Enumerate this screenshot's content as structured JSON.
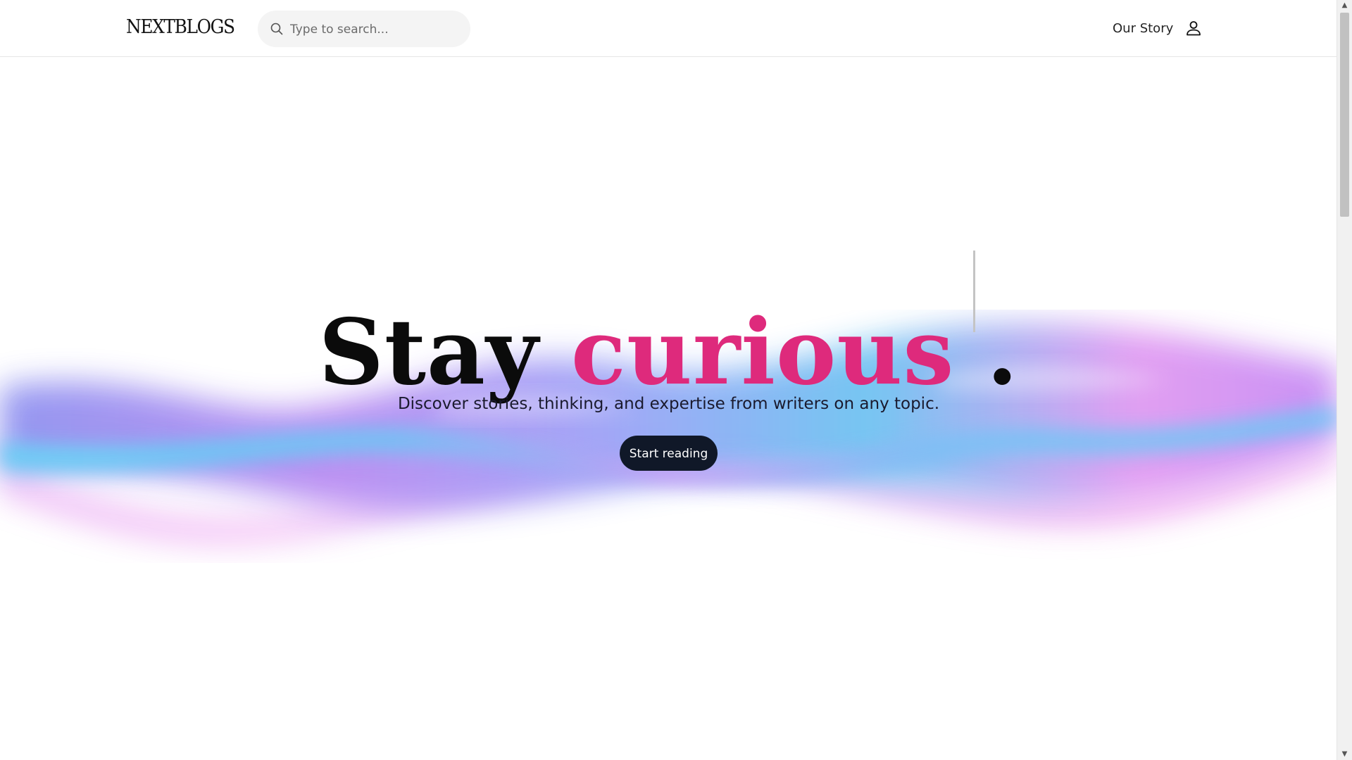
{
  "header": {
    "logo": "NEXTBLOGS",
    "search": {
      "placeholder": "Type to search...",
      "value": ""
    },
    "nav_link": "Our Story",
    "icons": {
      "search": "search-icon",
      "user": "user-icon"
    }
  },
  "hero": {
    "title_word1": "Stay",
    "title_word2": "curious",
    "title_punct": " .",
    "subtitle": "Discover stories, thinking, and expertise from writers on any topic.",
    "cta_label": "Start reading"
  },
  "colors": {
    "accent": "#de2a7c",
    "button": "#101828",
    "wave_cyan": "#5fd0f5",
    "wave_purple": "#b48ef5",
    "wave_pink": "#f3a6f0"
  },
  "scrollbar": {
    "up_arrow": "▲",
    "down_arrow": "▼"
  }
}
